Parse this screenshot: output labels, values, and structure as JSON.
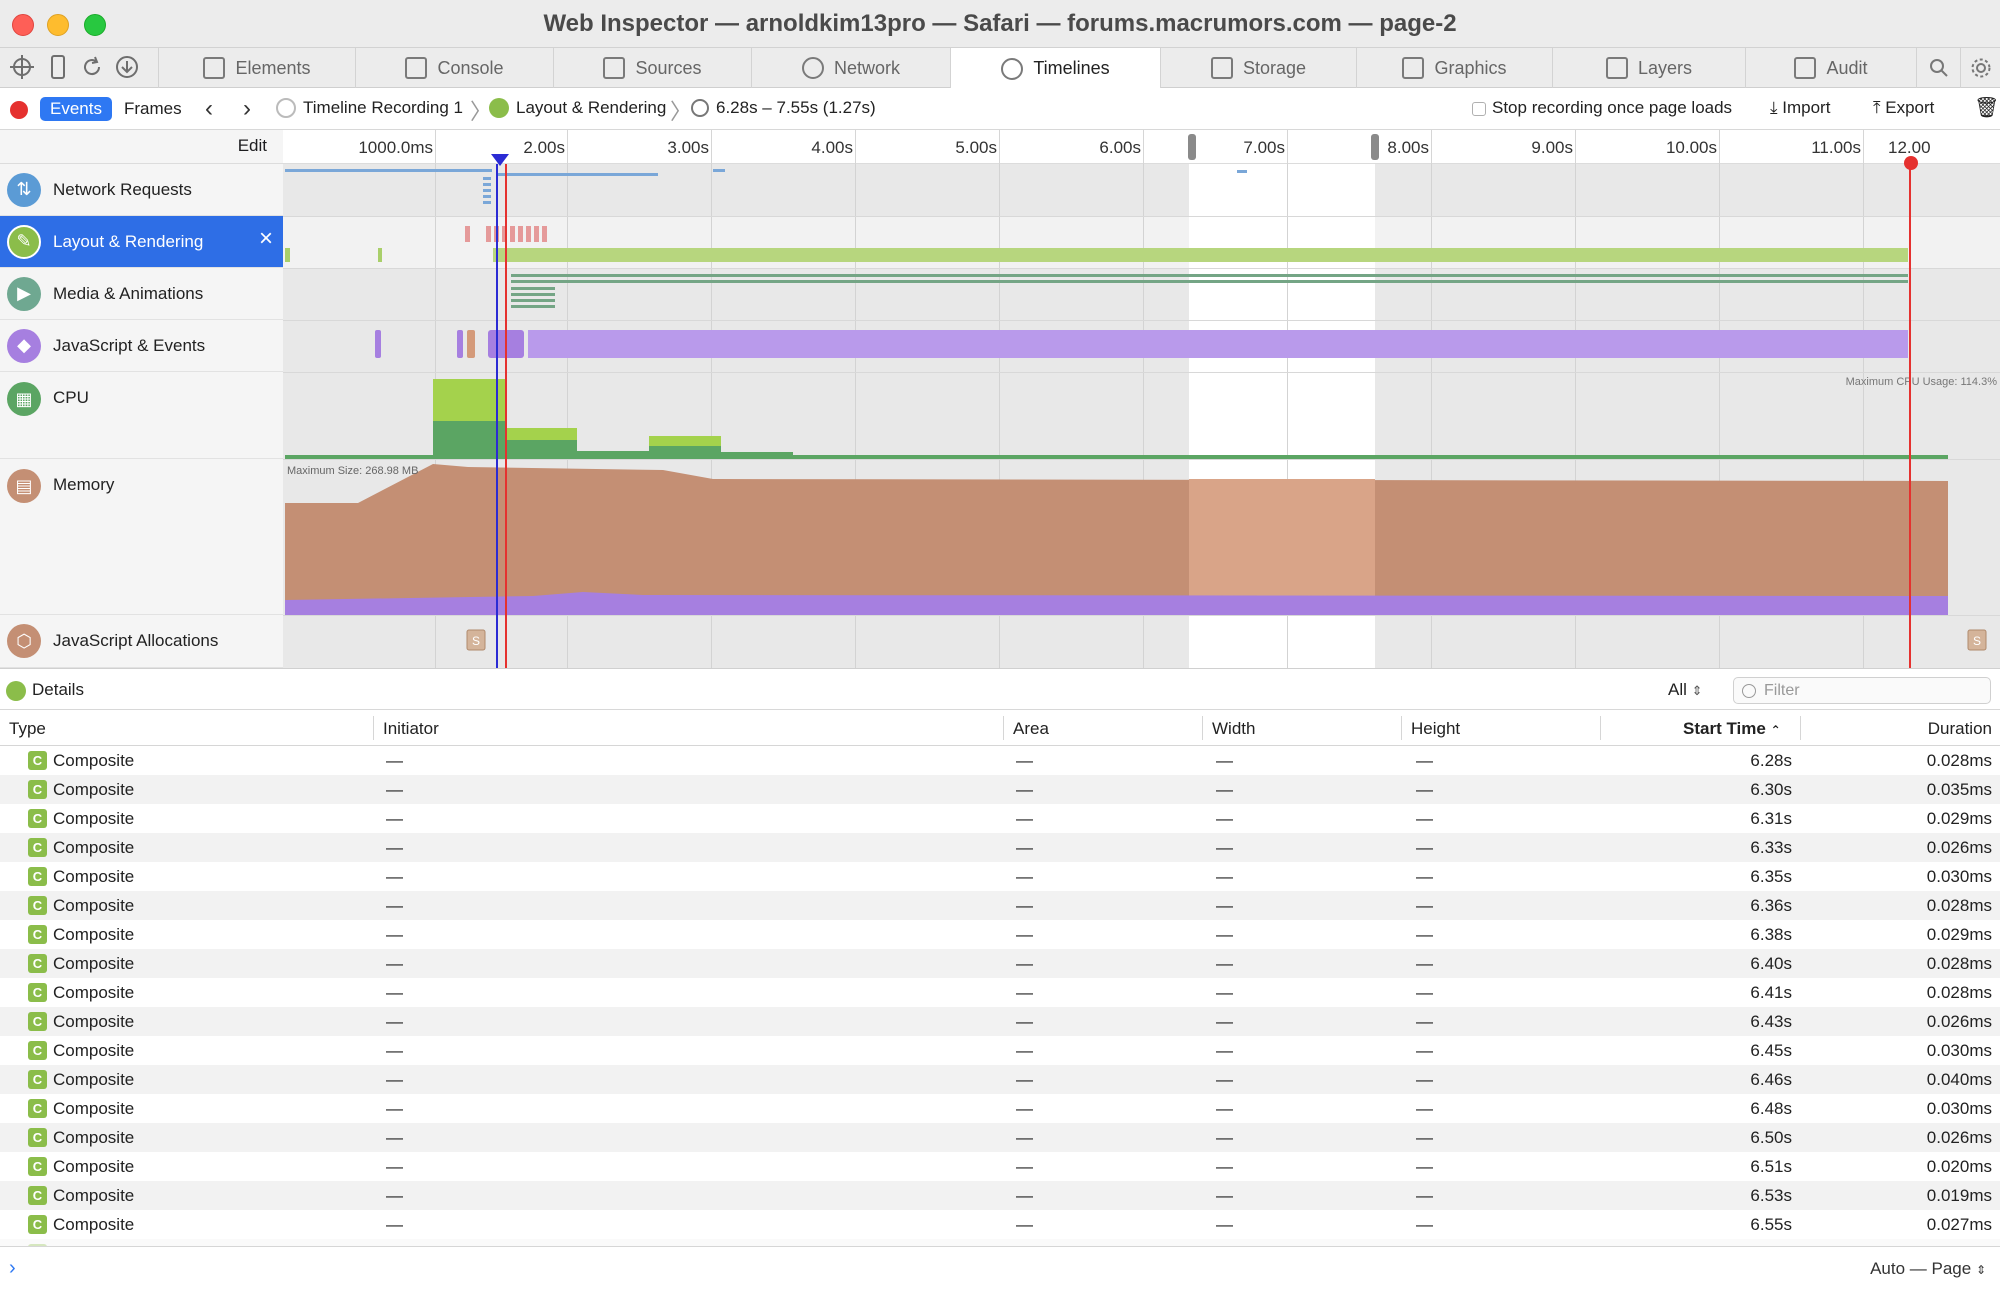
{
  "window": {
    "title": "Web Inspector — arnoldkim13pro — Safari — forums.macrumors.com — page-2"
  },
  "tabs": [
    {
      "label": "Elements"
    },
    {
      "label": "Console"
    },
    {
      "label": "Sources"
    },
    {
      "label": "Network"
    },
    {
      "label": "Timelines"
    },
    {
      "label": "Storage"
    },
    {
      "label": "Graphics"
    },
    {
      "label": "Layers"
    },
    {
      "label": "Audit"
    }
  ],
  "nav": {
    "events": "Events",
    "frames": "Frames",
    "recording": "Timeline Recording 1",
    "timeline": "Layout & Rendering",
    "range": "6.28s – 7.55s (1.27s)",
    "stop_label": "Stop recording once page loads",
    "import": "Import",
    "export": "Export"
  },
  "overview": {
    "edit": "Edit",
    "ruler_ticks": [
      "1000.0ms",
      "2.00s",
      "3.00s",
      "4.00s",
      "5.00s",
      "6.00s",
      "7.00s",
      "8.00s",
      "9.00s",
      "10.00s",
      "11.00s",
      "12.00"
    ],
    "rows": [
      {
        "label": "Network Requests"
      },
      {
        "label": "Layout & Rendering"
      },
      {
        "label": "Media & Animations"
      },
      {
        "label": "JavaScript & Events"
      },
      {
        "label": "CPU"
      },
      {
        "label": "Memory"
      },
      {
        "label": "JavaScript Allocations"
      }
    ],
    "cpu_max": "Maximum CPU Usage: 114.3%",
    "memory_max": "Maximum Size: 268.98 MB",
    "alloc_marker": "S"
  },
  "details": {
    "label": "Details",
    "filter_select": "All",
    "filter_placeholder": "Filter",
    "columns": {
      "type": "Type",
      "initiator": "Initiator",
      "area": "Area",
      "width": "Width",
      "height": "Height",
      "start": "Start Time",
      "duration": "Duration"
    },
    "record_icon": "C",
    "dash": "—",
    "rows": [
      {
        "type": "Composite",
        "start": "6.28s",
        "duration": "0.028ms"
      },
      {
        "type": "Composite",
        "start": "6.30s",
        "duration": "0.035ms"
      },
      {
        "type": "Composite",
        "start": "6.31s",
        "duration": "0.029ms"
      },
      {
        "type": "Composite",
        "start": "6.33s",
        "duration": "0.026ms"
      },
      {
        "type": "Composite",
        "start": "6.35s",
        "duration": "0.030ms"
      },
      {
        "type": "Composite",
        "start": "6.36s",
        "duration": "0.028ms"
      },
      {
        "type": "Composite",
        "start": "6.38s",
        "duration": "0.029ms"
      },
      {
        "type": "Composite",
        "start": "6.40s",
        "duration": "0.028ms"
      },
      {
        "type": "Composite",
        "start": "6.41s",
        "duration": "0.028ms"
      },
      {
        "type": "Composite",
        "start": "6.43s",
        "duration": "0.026ms"
      },
      {
        "type": "Composite",
        "start": "6.45s",
        "duration": "0.030ms"
      },
      {
        "type": "Composite",
        "start": "6.46s",
        "duration": "0.040ms"
      },
      {
        "type": "Composite",
        "start": "6.48s",
        "duration": "0.030ms"
      },
      {
        "type": "Composite",
        "start": "6.50s",
        "duration": "0.026ms"
      },
      {
        "type": "Composite",
        "start": "6.51s",
        "duration": "0.020ms"
      },
      {
        "type": "Composite",
        "start": "6.53s",
        "duration": "0.019ms"
      },
      {
        "type": "Composite",
        "start": "6.55s",
        "duration": "0.027ms"
      }
    ]
  },
  "status": {
    "prompt": "›",
    "mode": "Auto — Page"
  },
  "colors": {
    "accent": "#2e78f3",
    "recording": "#e5312f",
    "layout": "#8bbd4a",
    "js": "#a67fe0",
    "memory": "#c48f74"
  }
}
